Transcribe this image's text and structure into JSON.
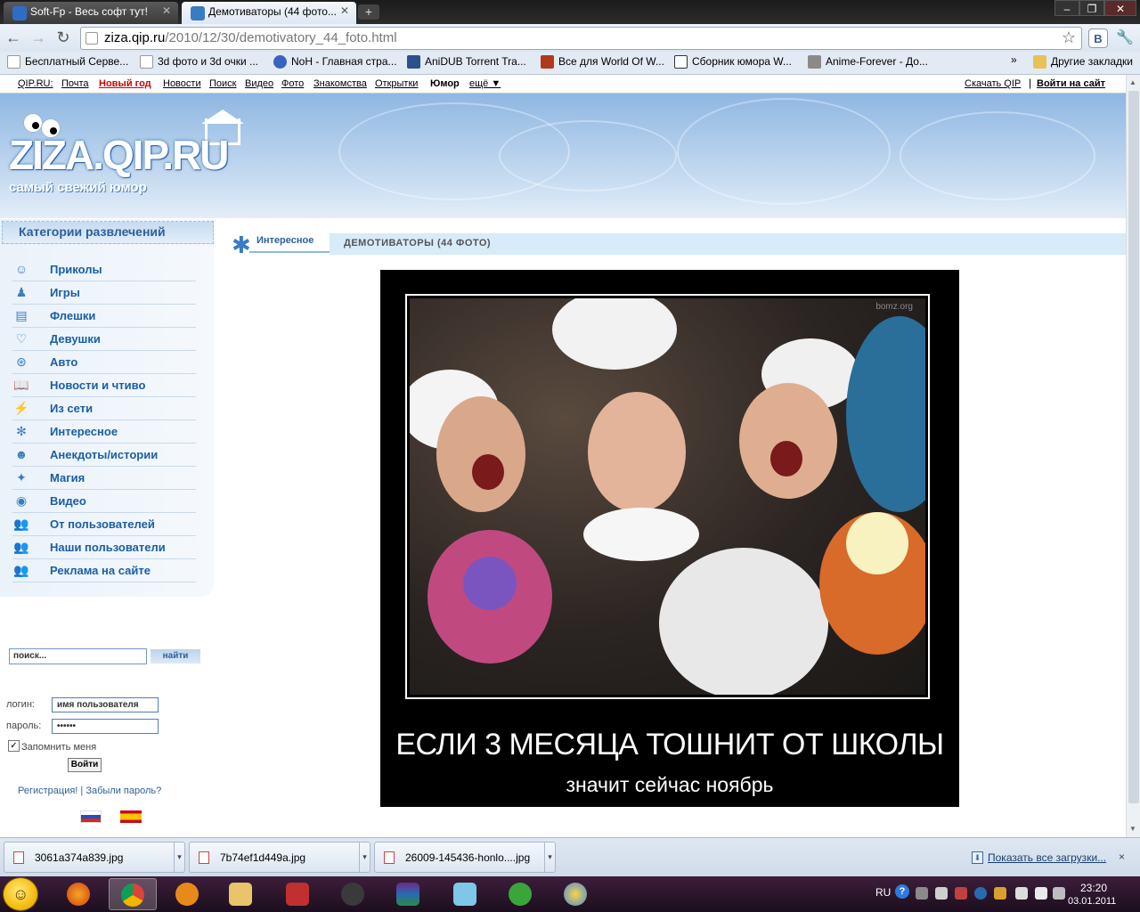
{
  "browser": {
    "tabs": [
      {
        "title": "Soft-Fp - Весь софт тут!",
        "active": false
      },
      {
        "title": "Демотиваторы (44 фото...",
        "active": true
      }
    ],
    "url_host": "ziza.qip.ru",
    "url_path": "/2010/12/30/demotivatory_44_foto.html",
    "bookmarks": [
      "Бесплатный Серве...",
      "3d фото и 3d очки ...",
      "NoH - Главная стра...",
      "AniDUB Torrent Tra...",
      "Все для World Of W...",
      "Сборник юмора W...",
      "Anime-Forever - До..."
    ],
    "other_bookmarks": "Другие закладки",
    "bookmarks_overflow": "»"
  },
  "topnav": {
    "items": [
      "QIP.RU:",
      "Почта",
      "Новый год",
      "Новости",
      "Поиск",
      "Видео",
      "Фото",
      "Знакомства",
      "Открытки",
      "Юмор",
      "ещё ▼"
    ],
    "download_qip": "Скачать QIP",
    "separator": "|",
    "login_site": "Войти на сайт"
  },
  "header": {
    "logo": "ZIZA.QIP.RU",
    "slogan": "самый свежий юмор"
  },
  "sidebar": {
    "title": "Категории развлечений",
    "categories": [
      "Приколы",
      "Игры",
      "Флешки",
      "Девушки",
      "Авто",
      "Новости и чтиво",
      "Из сети",
      "Интересное",
      "Анекдоты/истории",
      "Магия",
      "Видео",
      "От пользователей",
      "Наши пользователи",
      "Реклама на сайте"
    ],
    "search_value": "поиск...",
    "search_button": "найти",
    "login_label": "логин:",
    "login_value": "имя пользователя",
    "password_label": "пароль:",
    "password_value": "••••••",
    "remember_label": "Запомнить меня",
    "login_button": "Войти",
    "register_link": "Регистрация!",
    "links_separator": "|",
    "forgot_link": "Забыли пароль?"
  },
  "content": {
    "crumb_section": "Интересное",
    "crumb_title": "ДЕМОТИВАТОРЫ (44 ФОТО)",
    "demotivator": {
      "watermark": "bomz.org",
      "title": "ЕСЛИ 3 МЕСЯЦА ТОШНИТ ОТ ШКОЛЫ",
      "subtitle": "значит сейчас ноябрь"
    }
  },
  "downloads": {
    "items": [
      "3061a374a839.jpg",
      "7b74ef1d449a.jpg",
      "26009-145436-honlo....jpg"
    ],
    "show_all": "Показать все загрузки...",
    "close": "×"
  },
  "taskbar": {
    "lang": "RU",
    "help": "?",
    "time": "23:20",
    "date": "03.01.2011"
  },
  "colors": {
    "link_blue": "#1b5ea6",
    "accent_red": "#cc0000",
    "header_blue": "#8fb7e2",
    "crumb_bg": "#d7ebf8",
    "taskbar": "#2a1428"
  }
}
